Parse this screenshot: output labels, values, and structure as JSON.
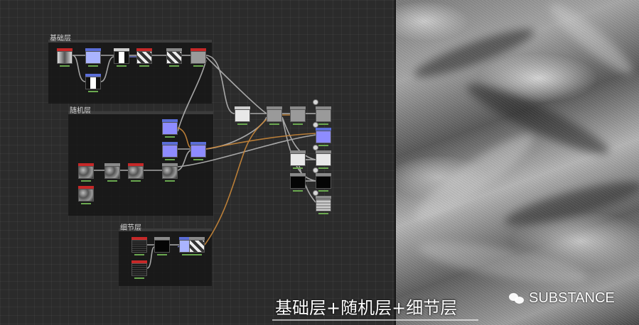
{
  "frames": {
    "base": {
      "label": "基础层"
    },
    "random": {
      "label": "随机层"
    },
    "detail": {
      "label": "细节层"
    }
  },
  "caption": "基础层+随机层+细节层",
  "watermark": {
    "text": "SUBSTANCE",
    "icon": "wechat-icon"
  },
  "colors": {
    "graph_background": "#2b2b2b",
    "node_header_red": "#c62828",
    "node_header_blue": "#5b6ed8",
    "wire_gray": "#bdbdbd",
    "wire_orange": "#c9873a",
    "normal_map_purple": "#8e8cff"
  }
}
